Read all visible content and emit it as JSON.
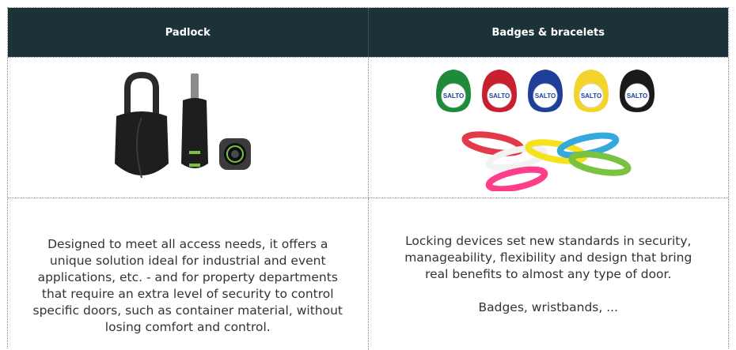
{
  "headers": [
    "Padlock",
    "Badges & bracelets"
  ],
  "padlock": {
    "description": "Designed to meet all access needs, it offers a unique solution ideal for industrial and event applications, etc. - and for property departments that require an extra level of security to control specific doors, such as container material, without losing comfort and control."
  },
  "badges": {
    "description": "Locking devices set new standards in security, manageability, flexibility and design that bring real benefits to almost any type of door.",
    "note": "Badges, wristbands, ...",
    "fob_label": "SALTO",
    "fob_colors": [
      "#1f8a3a",
      "#c8202f",
      "#1f3f99",
      "#f2d42b",
      "#1a1a1a"
    ],
    "bracelet_colors": [
      "#e23a4a",
      "#f2f2f2",
      "#f5e21e",
      "#35a8dc",
      "#7cc242",
      "#ff3d8a"
    ]
  }
}
